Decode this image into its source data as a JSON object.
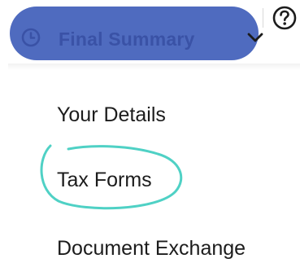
{
  "dropdown": {
    "label": "Final Summary",
    "icons": {
      "leading": "clock-icon",
      "trailing": "chevron-down-icon"
    }
  },
  "help": {
    "icon": "help-question-icon"
  },
  "menu": {
    "items": [
      {
        "label": "Your Details"
      },
      {
        "label": "Tax Forms"
      },
      {
        "label": "Document Exchange"
      }
    ]
  },
  "colors": {
    "pill_background": "#4f6bbf",
    "pill_text": "#3a52a6",
    "annotation_circle": "#4fd1c5",
    "menu_text": "#1c1c1c"
  }
}
